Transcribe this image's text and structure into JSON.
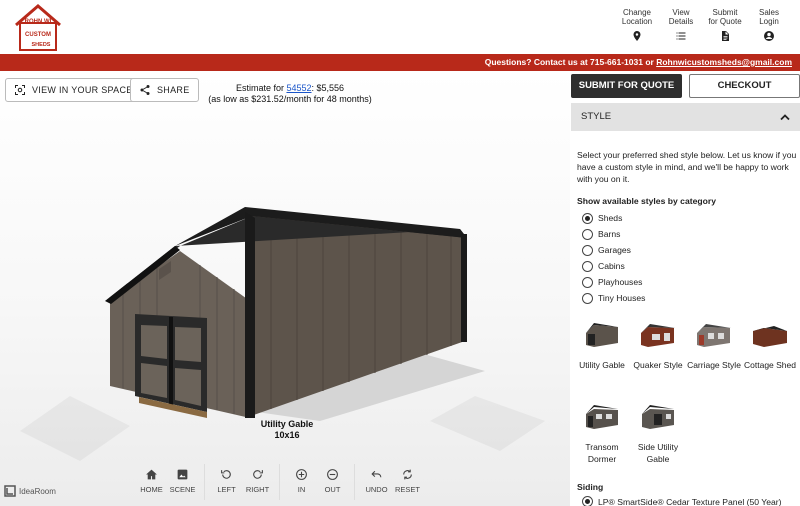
{
  "header": {
    "logo_text": [
      "ROHN WI",
      "CUSTOM",
      "SHEDS"
    ],
    "logo_color": "#b8291a",
    "nav": [
      {
        "label": "Change Location",
        "icon": "location-pin-icon"
      },
      {
        "label": "View Details",
        "icon": "list-icon"
      },
      {
        "label": "Submit for Quote",
        "icon": "document-icon"
      },
      {
        "label": "Sales Login",
        "icon": "account-icon"
      }
    ]
  },
  "banner": {
    "text": "Questions? Contact us at 715-661-1031 or ",
    "email": "Rohnwicustomsheds@gmail.com",
    "color": "#b8291a"
  },
  "viewer": {
    "view_in_space_label": "VIEW IN YOUR SPACE",
    "share_label": "SHARE",
    "estimate_prefix": "Estimate for ",
    "estimate_link": "54552",
    "estimate_price": ": $5,556",
    "estimate_monthly": "(as low as $231.52/month for 48 months)",
    "shed_name": "Utility Gable",
    "shed_size": "10x16",
    "watermark": "IdeaRoom"
  },
  "toolbar": {
    "groups": [
      [
        {
          "label": "HOME",
          "icon": "home-icon"
        },
        {
          "label": "SCENE",
          "icon": "image-icon"
        }
      ],
      [
        {
          "label": "LEFT",
          "icon": "rotate-left-icon"
        },
        {
          "label": "RIGHT",
          "icon": "rotate-right-icon"
        }
      ],
      [
        {
          "label": "IN",
          "icon": "zoom-in-icon"
        },
        {
          "label": "OUT",
          "icon": "zoom-out-icon"
        }
      ],
      [
        {
          "label": "UNDO",
          "icon": "undo-icon"
        },
        {
          "label": "RESET",
          "icon": "reset-icon"
        }
      ]
    ]
  },
  "panel": {
    "submit_label": "SUBMIT FOR QUOTE",
    "checkout_label": "CHECKOUT",
    "section_title": "STYLE",
    "intro": "Select your preferred shed style below. Let us know if you have a custom style in mind, and we'll be happy to work with you on it.",
    "category_title": "Show available styles by category",
    "categories": [
      {
        "label": "Sheds",
        "selected": true
      },
      {
        "label": "Barns",
        "selected": false
      },
      {
        "label": "Garages",
        "selected": false
      },
      {
        "label": "Cabins",
        "selected": false
      },
      {
        "label": "Playhouses",
        "selected": false
      },
      {
        "label": "Tiny Houses",
        "selected": false
      }
    ],
    "styles": [
      {
        "name": "Utility Gable"
      },
      {
        "name": "Quaker Style"
      },
      {
        "name": "Carriage Style"
      },
      {
        "name": "Cottage Shed"
      },
      {
        "name": "Transom Dormer"
      },
      {
        "name": "Side Utility Gable"
      }
    ],
    "siding_title": "Siding",
    "siding_option": "LP® SmartSide® Cedar Texture Panel (50 Year)"
  }
}
